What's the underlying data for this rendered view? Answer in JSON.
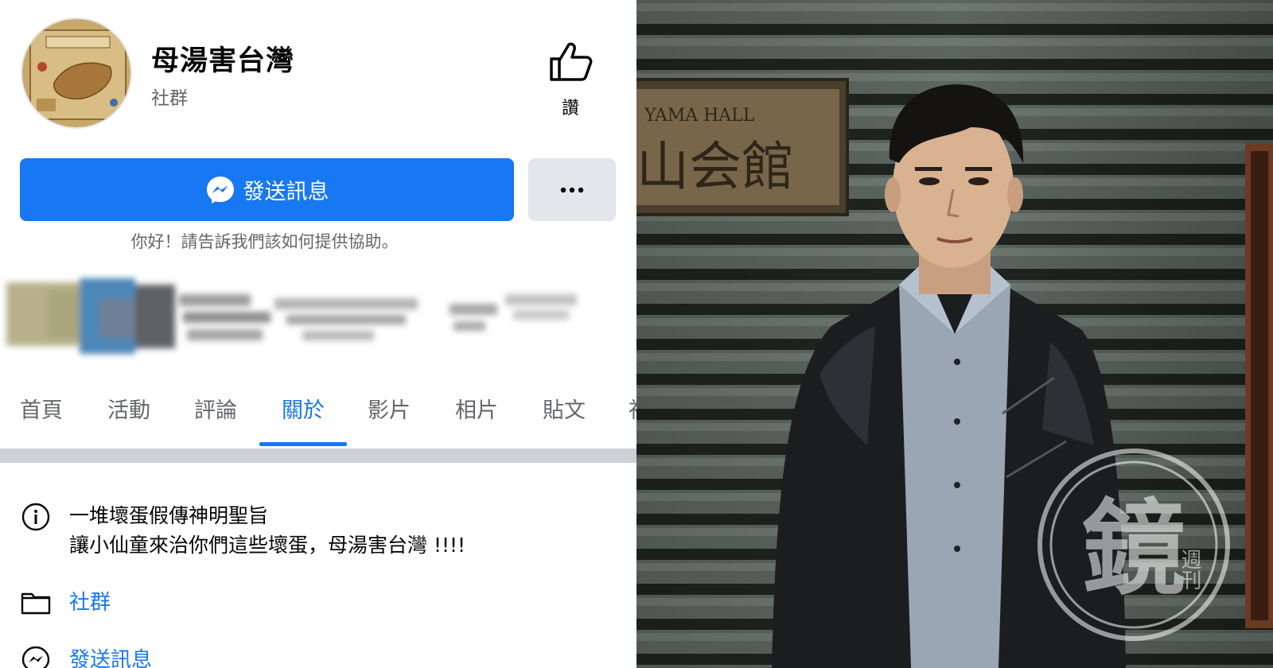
{
  "page": {
    "title": "母湯害台灣",
    "category": "社群"
  },
  "like": {
    "label": "讚",
    "icon": "thumbs-up-icon"
  },
  "actions": {
    "send_message_label": "發送訊息",
    "send_message_icon": "messenger-icon",
    "more_icon": "more-options-icon",
    "greeting": "你好！請告訴我們該如何提供協助。"
  },
  "tabs": [
    {
      "label": "首頁"
    },
    {
      "label": "活動"
    },
    {
      "label": "評論"
    },
    {
      "label": "關於",
      "active": true
    },
    {
      "label": "影片"
    },
    {
      "label": "相片"
    },
    {
      "label": "貼文"
    },
    {
      "label": "社"
    }
  ],
  "about": {
    "description_line1": "一堆壞蛋假傳神明聖旨",
    "description_line2": "讓小仙童來治你們這些壞蛋，母湯害台灣 !!!!",
    "category_link": "社群",
    "message_link": "發送訊息"
  },
  "photo": {
    "plaque_line1": "YAMA HALL",
    "plaque_line2": "山会館",
    "watermark_char": "鏡",
    "watermark_sub": "週刊"
  },
  "colors": {
    "accent": "#1877f2",
    "secondary_button": "#e4e6eb",
    "muted_text": "#65676b",
    "separator": "#cdd0d4"
  }
}
